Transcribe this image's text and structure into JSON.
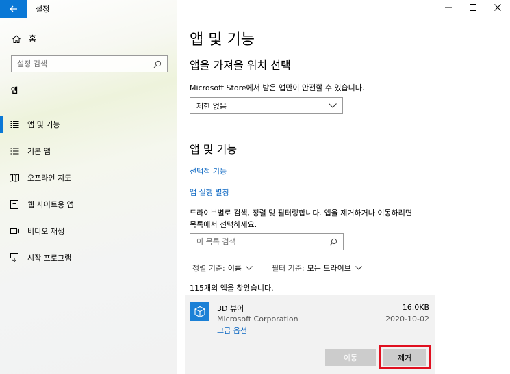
{
  "window": {
    "title": "설정",
    "controls": [
      "minimize",
      "maximize",
      "close"
    ]
  },
  "sidebar": {
    "home_label": "홈",
    "search_placeholder": "설정 검색",
    "section_label": "앱",
    "items": [
      {
        "label": "앱 및 기능",
        "icon": "list-icon",
        "active": true
      },
      {
        "label": "기본 앱",
        "icon": "default-apps-icon",
        "active": false
      },
      {
        "label": "오프라인 지도",
        "icon": "map-icon",
        "active": false
      },
      {
        "label": "웹 사이트용 앱",
        "icon": "web-app-icon",
        "active": false
      },
      {
        "label": "비디오 재생",
        "icon": "video-icon",
        "active": false
      },
      {
        "label": "시작 프로그램",
        "icon": "startup-icon",
        "active": false
      }
    ]
  },
  "main": {
    "page_title": "앱 및 기능",
    "install_section": {
      "heading": "앱을 가져올 위치 선택",
      "description": "Microsoft Store에서 받은 앱만이 안전할 수 있습니다.",
      "dropdown_value": "제한 없음"
    },
    "apps_section": {
      "heading": "앱 및 기능",
      "link_optional": "선택적 기능",
      "link_aliases": "앱 실행 별칭",
      "description_line1": "드라이브별로 검색, 정렬 및 필터링합니다. 앱을 제거하거나 이동하려면",
      "description_line2": "목록에서 선택하세요.",
      "search_placeholder": "이 목록 검색",
      "sort_label": "정렬 기준:",
      "sort_value": "이름",
      "filter_label": "필터 기준:",
      "filter_value": "모든 드라이브",
      "count_text": "115개의 앱을 찾았습니다."
    },
    "app_item": {
      "name": "3D 뷰어",
      "publisher": "Microsoft Corporation",
      "advanced_link": "고급 옵션",
      "size": "16.0KB",
      "date": "2020-10-02",
      "move_label": "이동",
      "remove_label": "제거"
    }
  },
  "colors": {
    "accent": "#0a78d6",
    "link": "#0a66c2",
    "highlight": "#e01020"
  }
}
